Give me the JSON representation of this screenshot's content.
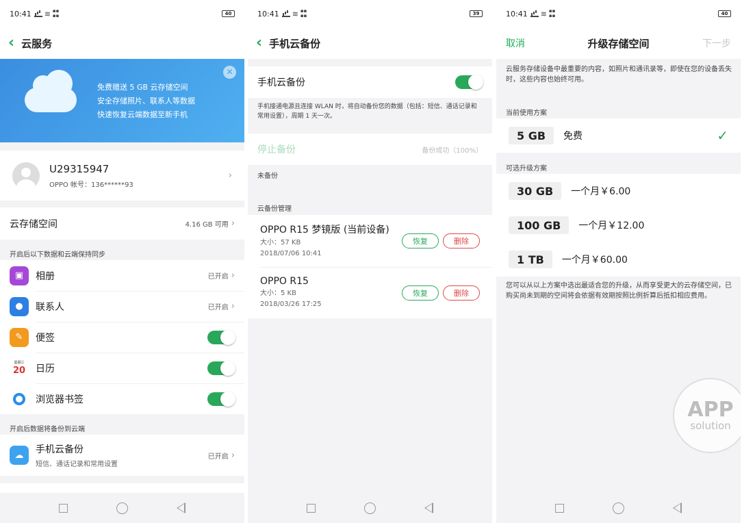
{
  "status_bar": {
    "time": "10:41",
    "battery_a": "40",
    "battery_b": "39",
    "battery_c": "40"
  },
  "screen1": {
    "title": "云服务",
    "banner": {
      "line1": "免费赠送 5 GB 云存储空间",
      "line2": "安全存储照片、联系人等数据",
      "line3": "快速恢复云端数据至新手机"
    },
    "account": {
      "username": "U29315947",
      "account_label": "OPPO 帐号：136******93"
    },
    "storage": {
      "label": "云存储空间",
      "value": "4.16 GB 可用"
    },
    "sync_header": "开启后以下数据和云端保持同步",
    "sync_items": [
      {
        "label": "相册",
        "status": "已开启",
        "icon": "photo-icon"
      },
      {
        "label": "联系人",
        "status": "已开启",
        "icon": "contacts-icon"
      },
      {
        "label": "便签",
        "icon": "notes-icon"
      },
      {
        "label": "日历",
        "icon": "calendar-icon",
        "icon_top": "星期三",
        "icon_day": "20"
      },
      {
        "label": "浏览器书签",
        "icon": "browser-icon"
      }
    ],
    "backup_header": "开启后数据将备份到云端",
    "backup_item": {
      "label": "手机云备份",
      "sub": "短信、通话记录和常用设置",
      "status": "已开启"
    }
  },
  "screen2": {
    "title": "手机云备份",
    "toggle_label": "手机云备份",
    "description": "手机接通电源且连接 WLAN 时，将自动备份您的数据（包括：短信、通话记录和常用设置），周期 1 天一次。",
    "stop_label": "停止备份",
    "stop_status": "备份成功（100%）",
    "not_backed": "未备份",
    "manage_header": "云备份管理",
    "devices": [
      {
        "name": "OPPO R15 梦镜版 (当前设备)",
        "size": "大小：57 KB",
        "date": "2018/07/06 10:41",
        "restore": "恢复",
        "delete": "删除"
      },
      {
        "name": "OPPO R15",
        "size": "大小：5 KB",
        "date": "2018/03/26 17:25",
        "restore": "恢复",
        "delete": "删除"
      }
    ]
  },
  "screen3": {
    "cancel": "取消",
    "title": "升级存储空间",
    "next": "下一步",
    "intro": "云服务存储设备中最重要的内容，如照片和通讯录等，即使在您的设备丢失时，这些内容也始终可用。",
    "current_header": "当前使用方案",
    "current_plan": {
      "size": "5 GB",
      "price": "免费"
    },
    "upgrade_header": "可选升级方案",
    "plans": [
      {
        "size": "30 GB",
        "price": "一个月￥6.00"
      },
      {
        "size": "100 GB",
        "price": "一个月￥12.00"
      },
      {
        "size": "1 TB",
        "price": "一个月￥60.00"
      }
    ],
    "footnote": "您可以从以上方案中选出最适合您的升级，从而享受更大的云存储空间，已购买尚未到期的空间将会依据有效期按照比例折算后抵扣相应费用。",
    "watermark": {
      "line1": "APP",
      "line2": "solution"
    }
  }
}
